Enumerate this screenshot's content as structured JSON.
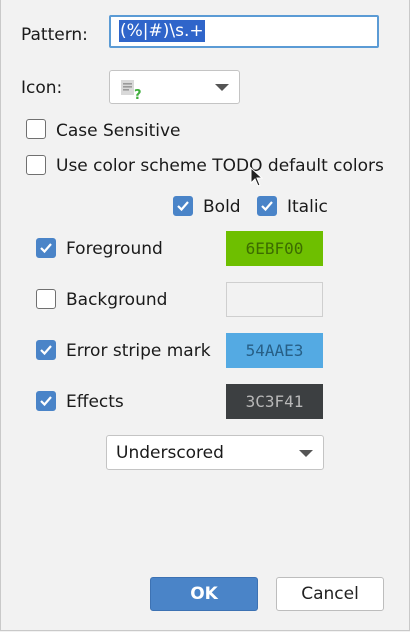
{
  "form": {
    "pattern_label": "Pattern:",
    "pattern_value": "(%|#)\\s.+",
    "icon_label": "Icon:",
    "case_sensitive_label": "Case Sensitive",
    "case_sensitive_checked": false,
    "use_color_scheme_label": "Use color scheme TODO default colors",
    "use_color_scheme_checked": false
  },
  "style": {
    "bold_label": "Bold",
    "bold_checked": true,
    "italic_label": "Italic",
    "italic_checked": true
  },
  "colors": [
    {
      "label": "Foreground",
      "checked": true,
      "hex": "6EBF00",
      "swatch_color": "#6EBF00"
    },
    {
      "label": "Background",
      "checked": false,
      "hex": "",
      "swatch_color": "#f2f2f2"
    },
    {
      "label": "Error stripe mark",
      "checked": true,
      "hex": "54AAE3",
      "swatch_color": "#54AAE3"
    },
    {
      "label": "Effects",
      "checked": true,
      "hex": "3C3F41",
      "swatch_color": "#3C3F41"
    }
  ],
  "effect_type": {
    "selected": "Underscored"
  },
  "buttons": {
    "ok_label": "OK",
    "cancel_label": "Cancel"
  },
  "accent_color": "#4a84c8"
}
